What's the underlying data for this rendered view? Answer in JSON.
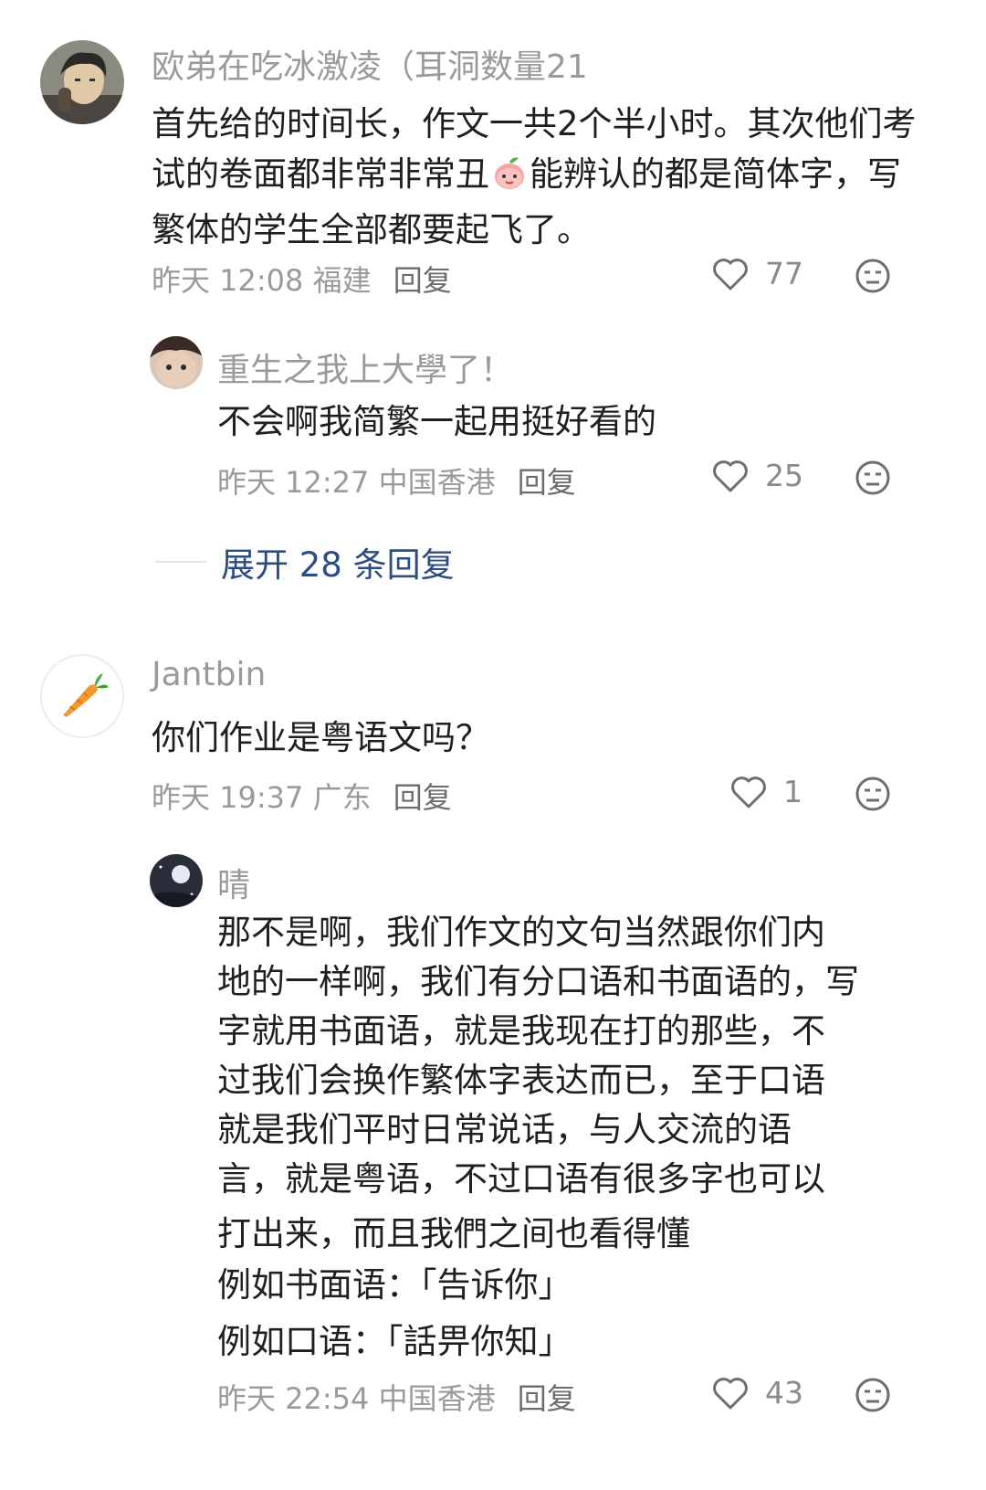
{
  "comments": [
    {
      "username": "欧弟在吃冰激凌（耳洞数量21",
      "content_part1": "首先给的时间长，作文一共2个半小时。其次他们考试的卷面都非常非常丑",
      "emoji": "peach-face-emoji",
      "content_part2": "能辨认的都是简体字，写繁体的学生全部都要起飞了。",
      "date": "昨天 12:08",
      "location": "福建",
      "reply_label": "回复",
      "likes": "77",
      "reply": {
        "username": "重生之我上大學了！",
        "content": "不会啊我简繁一起用挺好看的",
        "date": "昨天 12:27",
        "location": "中国香港",
        "reply_label": "回复",
        "likes": "25"
      },
      "expand_label": "展开 28 条回复"
    },
    {
      "username": "Jantbin",
      "content": "你们作业是粤语文吗？",
      "date": "昨天 19:37",
      "location": "广东",
      "reply_label": "回复",
      "likes": "1",
      "reply": {
        "username": "晴",
        "content_lines": [
          "那不是啊，我们作文的文句当然跟你们内",
          "地的一样啊，我们有分口语和书面语的，写",
          "字就用书面语，就是我现在打的那些，不",
          "过我们会换作繁体字表达而已，至于口语",
          "就是我们平时日常说话，与人交流的语",
          "言，就是粤语，不过口语有很多字也可以",
          "打出来，而且我們之间也看得懂",
          "例如书面语：「告诉你」",
          "例如口语：「話畀你知」"
        ],
        "date": "昨天 22:54",
        "location": "中国香港",
        "reply_label": "回复",
        "likes": "43"
      }
    }
  ],
  "icons": {
    "like": "heart-outline-icon",
    "dislike": "neutral-face-icon"
  },
  "colors": {
    "meta": "#9a9a9a",
    "text": "#1f1f1f",
    "expand": "#2d4d80"
  }
}
